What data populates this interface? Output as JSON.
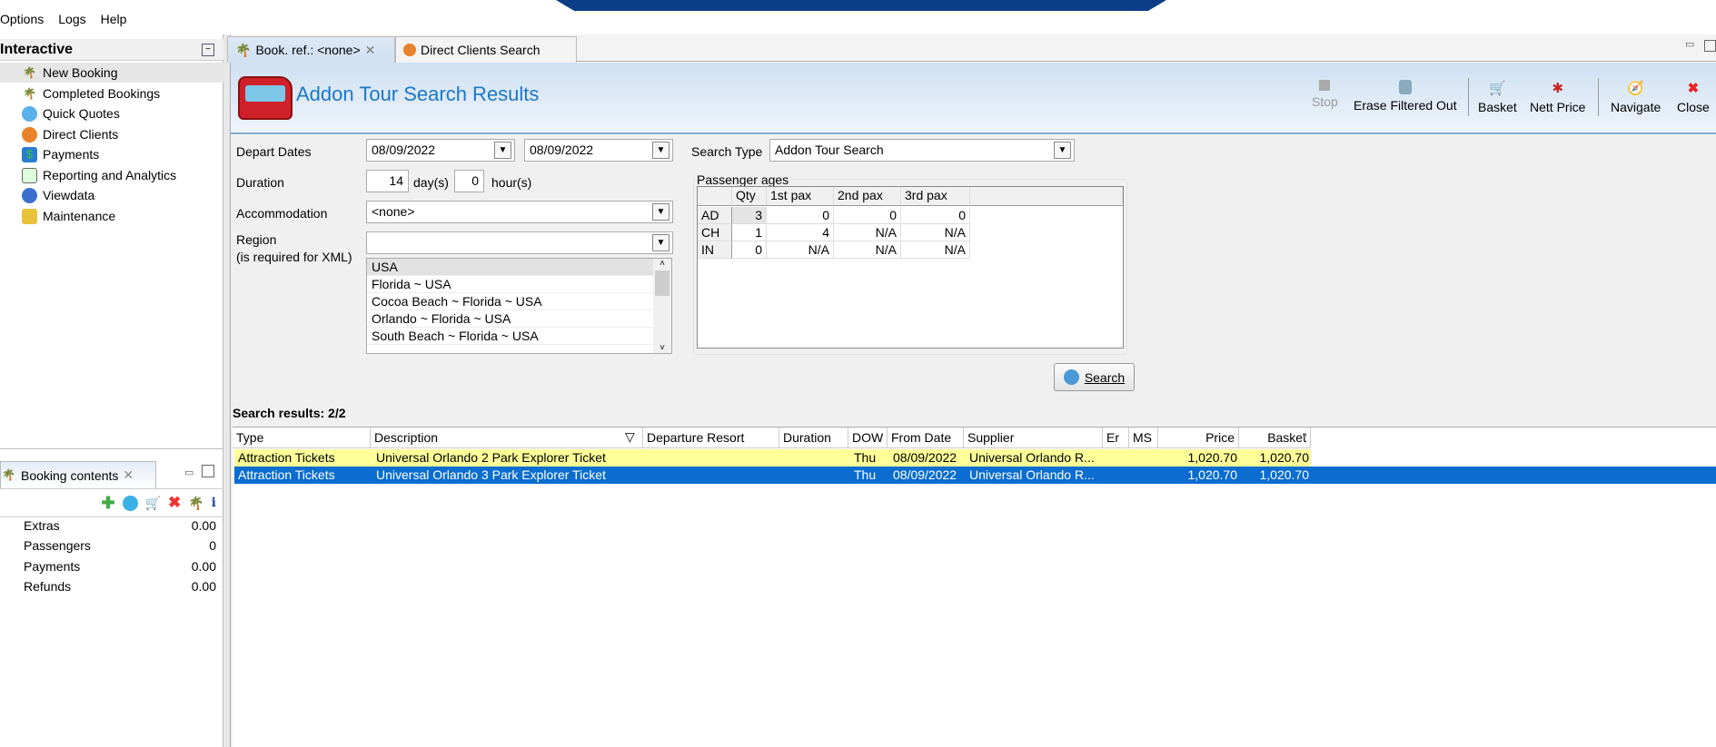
{
  "menu": [
    "Options",
    "Logs",
    "Help"
  ],
  "left": {
    "title": "Interactive",
    "items": [
      "New Booking",
      "Completed Bookings",
      "Quick Quotes",
      "Direct Clients",
      "Payments",
      "Reporting and Analytics",
      "Viewdata",
      "Maintenance"
    ],
    "selected": "New Booking"
  },
  "booking_contents": {
    "tab": "Booking contents",
    "rows": [
      {
        "label": "Extras",
        "value": "0.00"
      },
      {
        "label": "Passengers",
        "value": "0"
      },
      {
        "label": "Payments",
        "value": "0.00"
      },
      {
        "label": "Refunds",
        "value": "0.00"
      }
    ]
  },
  "tabs": [
    "Book. ref.: <none>",
    "Direct Clients Search"
  ],
  "page_title": "Addon Tour Search Results",
  "toolbar": {
    "stop": "Stop",
    "erase": "Erase Filtered Out",
    "basket": "Basket",
    "nett": "Nett Price",
    "navigate": "Navigate",
    "close": "Close"
  },
  "form": {
    "depart_label": "Depart Dates",
    "date_from": "08/09/2022",
    "date_to": "08/09/2022",
    "search_type_label": "Search Type",
    "search_type": "Addon Tour Search",
    "duration_label": "Duration",
    "days": "14",
    "days_unit": "day(s)",
    "hours": "0",
    "hours_unit": "hour(s)",
    "accommodation_label": "Accommodation",
    "accommodation": "<none>",
    "region_label": "Region",
    "region_note": "(is required for XML)",
    "region_value": "",
    "regions": [
      "USA",
      "Florida ~ USA",
      "Cocoa Beach ~ Florida ~ USA",
      "Orlando ~ Florida ~ USA",
      "South Beach ~ Florida ~ USA"
    ]
  },
  "pax": {
    "label": "Passenger ages",
    "headers": [
      "",
      "Qty",
      "1st pax",
      "2nd pax",
      "3rd pax"
    ],
    "rows": [
      [
        "AD",
        "3",
        "0",
        "0",
        "0"
      ],
      [
        "CH",
        "1",
        "4",
        "N/A",
        "N/A"
      ],
      [
        "IN",
        "0",
        "N/A",
        "N/A",
        "N/A"
      ]
    ]
  },
  "search_button": "Search",
  "results": {
    "label": "Search results: 2/2",
    "headers": [
      "Type",
      "Description",
      "Departure Resort",
      "Duration",
      "DOW",
      "From Date",
      "Supplier",
      "Er",
      "MS",
      "Price",
      "Basket"
    ],
    "rows": [
      [
        "Attraction Tickets",
        "Universal Orlando 2 Park Explorer Ticket",
        "",
        "",
        "Thu",
        "08/09/2022",
        "Universal Orlando R...",
        "",
        "",
        "1,020.70",
        "1,020.70"
      ],
      [
        "Attraction Tickets",
        "Universal Orlando 3 Park Explorer Ticket",
        "",
        "",
        "Thu",
        "08/09/2022",
        "Universal Orlando R...",
        "",
        "",
        "1,020.70",
        "1,020.70"
      ]
    ]
  }
}
